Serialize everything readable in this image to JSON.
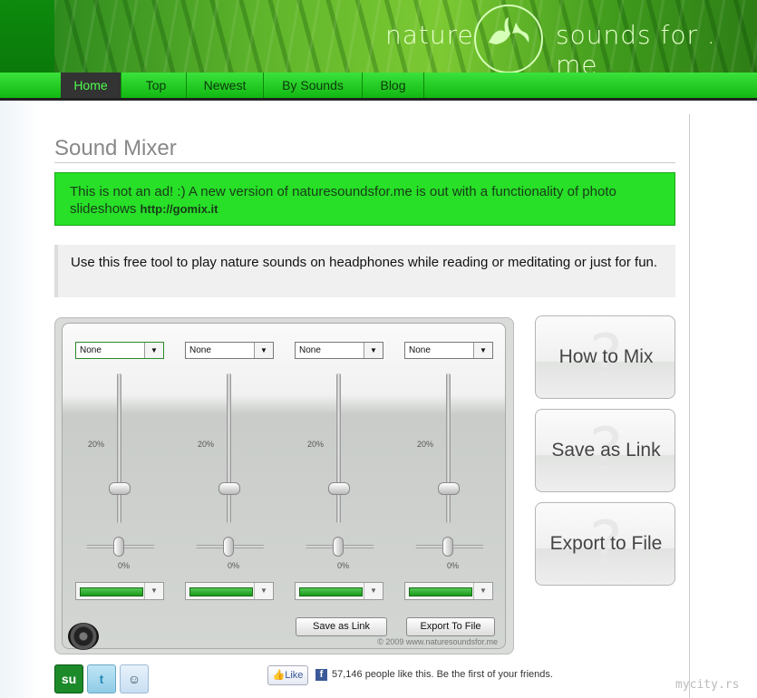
{
  "header": {
    "logo_left": "nature",
    "logo_right": "sounds for . me"
  },
  "nav": {
    "items": [
      {
        "label": "Home",
        "active": true
      },
      {
        "label": "Top"
      },
      {
        "label": "Newest"
      },
      {
        "label": "By Sounds"
      },
      {
        "label": "Blog"
      }
    ]
  },
  "page": {
    "title": "Sound Mixer",
    "notice_text": "This is not an ad! :) A new version of naturesoundsfor.me is out with a functionality of photo slideshows",
    "notice_link": "http://gomix.it",
    "info_text": "Use this free tool to play nature sounds on headphones while reading or meditating or just for fun."
  },
  "mixer": {
    "channels": [
      {
        "sound": "None",
        "volume_label": "20%",
        "pan_label": "0%",
        "volume": 20,
        "pan": 0
      },
      {
        "sound": "None",
        "volume_label": "20%",
        "pan_label": "0%",
        "volume": 20,
        "pan": 0
      },
      {
        "sound": "None",
        "volume_label": "20%",
        "pan_label": "0%",
        "volume": 20,
        "pan": 0
      },
      {
        "sound": "None",
        "volume_label": "20%",
        "pan_label": "0%",
        "volume": 20,
        "pan": 0
      }
    ],
    "save_link_label": "Save as Link",
    "export_file_label": "Export To File",
    "copyright": "© 2009 www.naturesoundsfor.me"
  },
  "side_buttons": {
    "how_to_mix": "How to Mix",
    "save_as_link": "Save as Link",
    "export_to_file": "Export to File"
  },
  "social": {
    "like_label": "Like",
    "like_text": "57,146 people like this. Be the first of your friends.",
    "icons": [
      "stumbleupon-icon",
      "twitter-icon",
      "reddit-icon"
    ]
  },
  "watermark": "mycity.rs",
  "colors": {
    "accent_green": "#27e027",
    "nav_green": "#22cc22",
    "active_text": "#4cff4c"
  }
}
